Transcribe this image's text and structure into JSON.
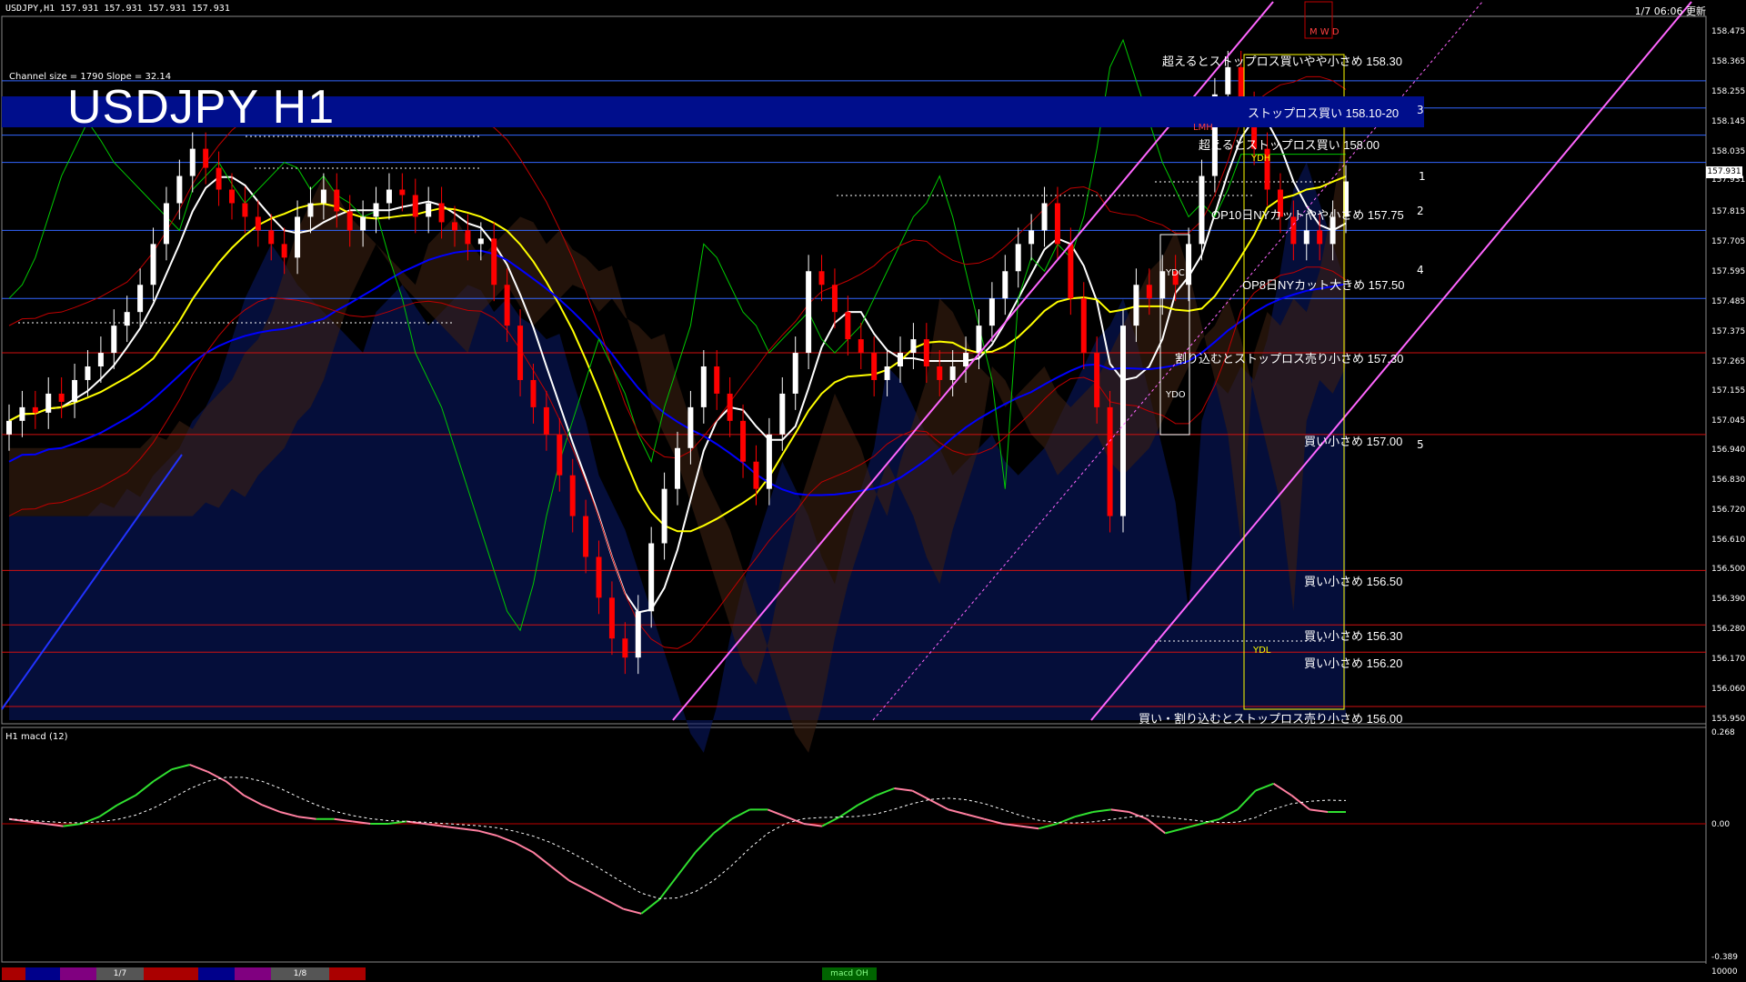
{
  "header": {
    "symbol_info": "USDJPY,H1  157.931 157.931 157.931 157.931",
    "timestamp": "1/7 06:06 更新",
    "channel_info": "Channel size = 1790 Slope = 32.14",
    "title": "USDJPY H1"
  },
  "price_axis": {
    "ticks": [
      "158.475",
      "158.365",
      "158.255",
      "158.145",
      "158.035",
      "157.931",
      "157.815",
      "157.705",
      "157.595",
      "157.485",
      "157.375",
      "157.265",
      "157.155",
      "157.045",
      "156.940",
      "156.830",
      "156.720",
      "156.610",
      "156.500",
      "156.390",
      "156.280",
      "156.170",
      "156.060",
      "155.950"
    ],
    "current_price": "157.931"
  },
  "macd_axis": {
    "label": "H1  macd (12)",
    "ticks": [
      "0.268",
      "0.00",
      "-0.389"
    ],
    "bottom_value": "10000"
  },
  "annotations": [
    {
      "text": "超えるとストップロス買いやや小さめ 158.30"
    },
    {
      "text": "ストップロス買い 158.10-20"
    },
    {
      "text": "超えるとストップロス買い 158.00"
    },
    {
      "text": "OP10日NYカットやや小さめ 157.75"
    },
    {
      "text": "OP8日NYカット大きめ 157.50"
    },
    {
      "text": "割り込むとストップロス売り小さめ 157.30"
    },
    {
      "text": "買い小さめ 157.00"
    },
    {
      "text": "買い小さめ 156.50"
    },
    {
      "text": "買い小さめ 156.30"
    },
    {
      "text": "買い小さめ 156.20"
    },
    {
      "text": "買い・割り込むとストップロス売り小さめ 156.00"
    }
  ],
  "level_numbers": [
    "1",
    "2",
    "3",
    "4",
    "5"
  ],
  "box_labels": {
    "ydh": "YDH",
    "ydl": "YDL",
    "ydc": "YDC",
    "ydo": "YDO",
    "lmh": "LMH",
    "mwd": "M W D"
  },
  "bottom_bar": {
    "date1": "1/7",
    "date2": "1/8",
    "macd_tab": "macd OH"
  },
  "colors": {
    "bull": "#ffffff",
    "bear": "#ff0000",
    "ma_white": "#ffffff",
    "ma_yellow": "#ffff00",
    "ma_blue": "#0000ff",
    "green": "#00c800",
    "channel": "#ff66ff",
    "title_bg": "#000e8c"
  },
  "chart_data": {
    "type": "line",
    "title": "USDJPY H1",
    "xlabel": "",
    "ylabel": "",
    "ylim": [
      155.95,
      158.53
    ],
    "horizontal_levels": [
      158.3,
      158.2,
      158.1,
      158.0,
      157.75,
      157.5,
      157.3,
      157.0,
      156.5,
      156.3,
      156.2,
      156.0
    ],
    "close_series": [
      157.05,
      157.1,
      157.08,
      157.15,
      157.12,
      157.2,
      157.25,
      157.3,
      157.4,
      157.45,
      157.55,
      157.7,
      157.85,
      157.95,
      158.05,
      157.98,
      157.9,
      157.85,
      157.8,
      157.75,
      157.7,
      157.65,
      157.8,
      157.85,
      157.9,
      157.82,
      157.75,
      157.8,
      157.85,
      157.9,
      157.88,
      157.8,
      157.85,
      157.78,
      157.75,
      157.7,
      157.72,
      157.55,
      157.4,
      157.2,
      157.1,
      157.0,
      156.85,
      156.7,
      156.55,
      156.4,
      156.25,
      156.18,
      156.35,
      156.6,
      156.8,
      156.95,
      157.1,
      157.25,
      157.15,
      157.05,
      156.9,
      156.8,
      157.0,
      157.15,
      157.3,
      157.6,
      157.55,
      157.45,
      157.35,
      157.3,
      157.2,
      157.25,
      157.3,
      157.35,
      157.25,
      157.2,
      157.25,
      157.3,
      157.4,
      157.5,
      157.6,
      157.7,
      157.75,
      157.85,
      157.7,
      157.5,
      157.3,
      157.1,
      156.7,
      157.4,
      157.55,
      157.5,
      157.6,
      157.55,
      157.7,
      157.95,
      158.25,
      158.35,
      158.2,
      158.05,
      157.9,
      157.8,
      157.7,
      157.75,
      157.7,
      157.8,
      157.93
    ],
    "macd": [
      0.02,
      0.01,
      0.0,
      -0.01,
      0.0,
      0.03,
      0.08,
      0.12,
      0.18,
      0.23,
      0.25,
      0.22,
      0.18,
      0.12,
      0.08,
      0.05,
      0.03,
      0.02,
      0.02,
      0.01,
      0.0,
      0.0,
      0.01,
      0.0,
      -0.01,
      -0.02,
      -0.03,
      -0.05,
      -0.08,
      -0.12,
      -0.18,
      -0.24,
      -0.28,
      -0.32,
      -0.36,
      -0.38,
      -0.32,
      -0.22,
      -0.12,
      -0.04,
      0.02,
      0.06,
      0.06,
      0.03,
      0.0,
      -0.01,
      0.03,
      0.08,
      0.12,
      0.15,
      0.14,
      0.1,
      0.06,
      0.04,
      0.02,
      0.0,
      -0.01,
      -0.02,
      0.0,
      0.03,
      0.05,
      0.06,
      0.05,
      0.02,
      -0.04,
      -0.02,
      0.0,
      0.02,
      0.06,
      0.14,
      0.17,
      0.12,
      0.06,
      0.05,
      0.05
    ]
  }
}
